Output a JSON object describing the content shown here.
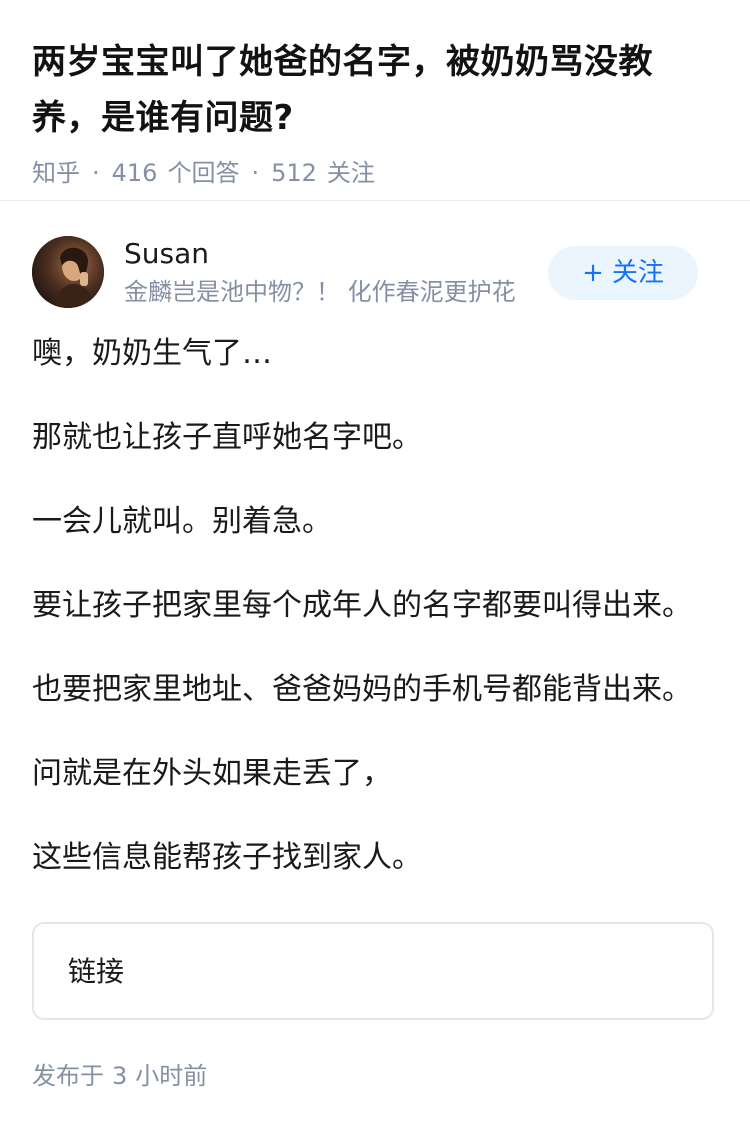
{
  "question": {
    "title": "两岁宝宝叫了她爸的名字，被奶奶骂没教养，是谁有问题?",
    "site": "知乎",
    "answer_count": "416",
    "answer_label": "个回答",
    "follow_count": "512",
    "follow_label": "关注"
  },
  "author": {
    "name": "Susan",
    "bio": "金麟岂是池中物？！ 化作春泥更护花",
    "follow_button": "关注",
    "follow_icon": "plus-icon"
  },
  "answer": {
    "paragraphs": [
      "噢，奶奶生气了…",
      "那就也让孩子直呼她名字吧。",
      "一会儿就叫。别着急。",
      "要让孩子把家里每个成年人的名字都要叫得出来。",
      "也要把家里地址、爸爸妈妈的手机号都能背出来。",
      "问就是在外头如果走丢了，",
      "这些信息能帮孩子找到家人。"
    ],
    "link_card_label": "链接",
    "publish_prefix": "发布于",
    "publish_num": "3",
    "publish_suffix": "小时前"
  },
  "colors": {
    "meta_gray": "#8590a6",
    "accent_blue": "#1772f6",
    "follow_bg": "#ebf5fd"
  }
}
